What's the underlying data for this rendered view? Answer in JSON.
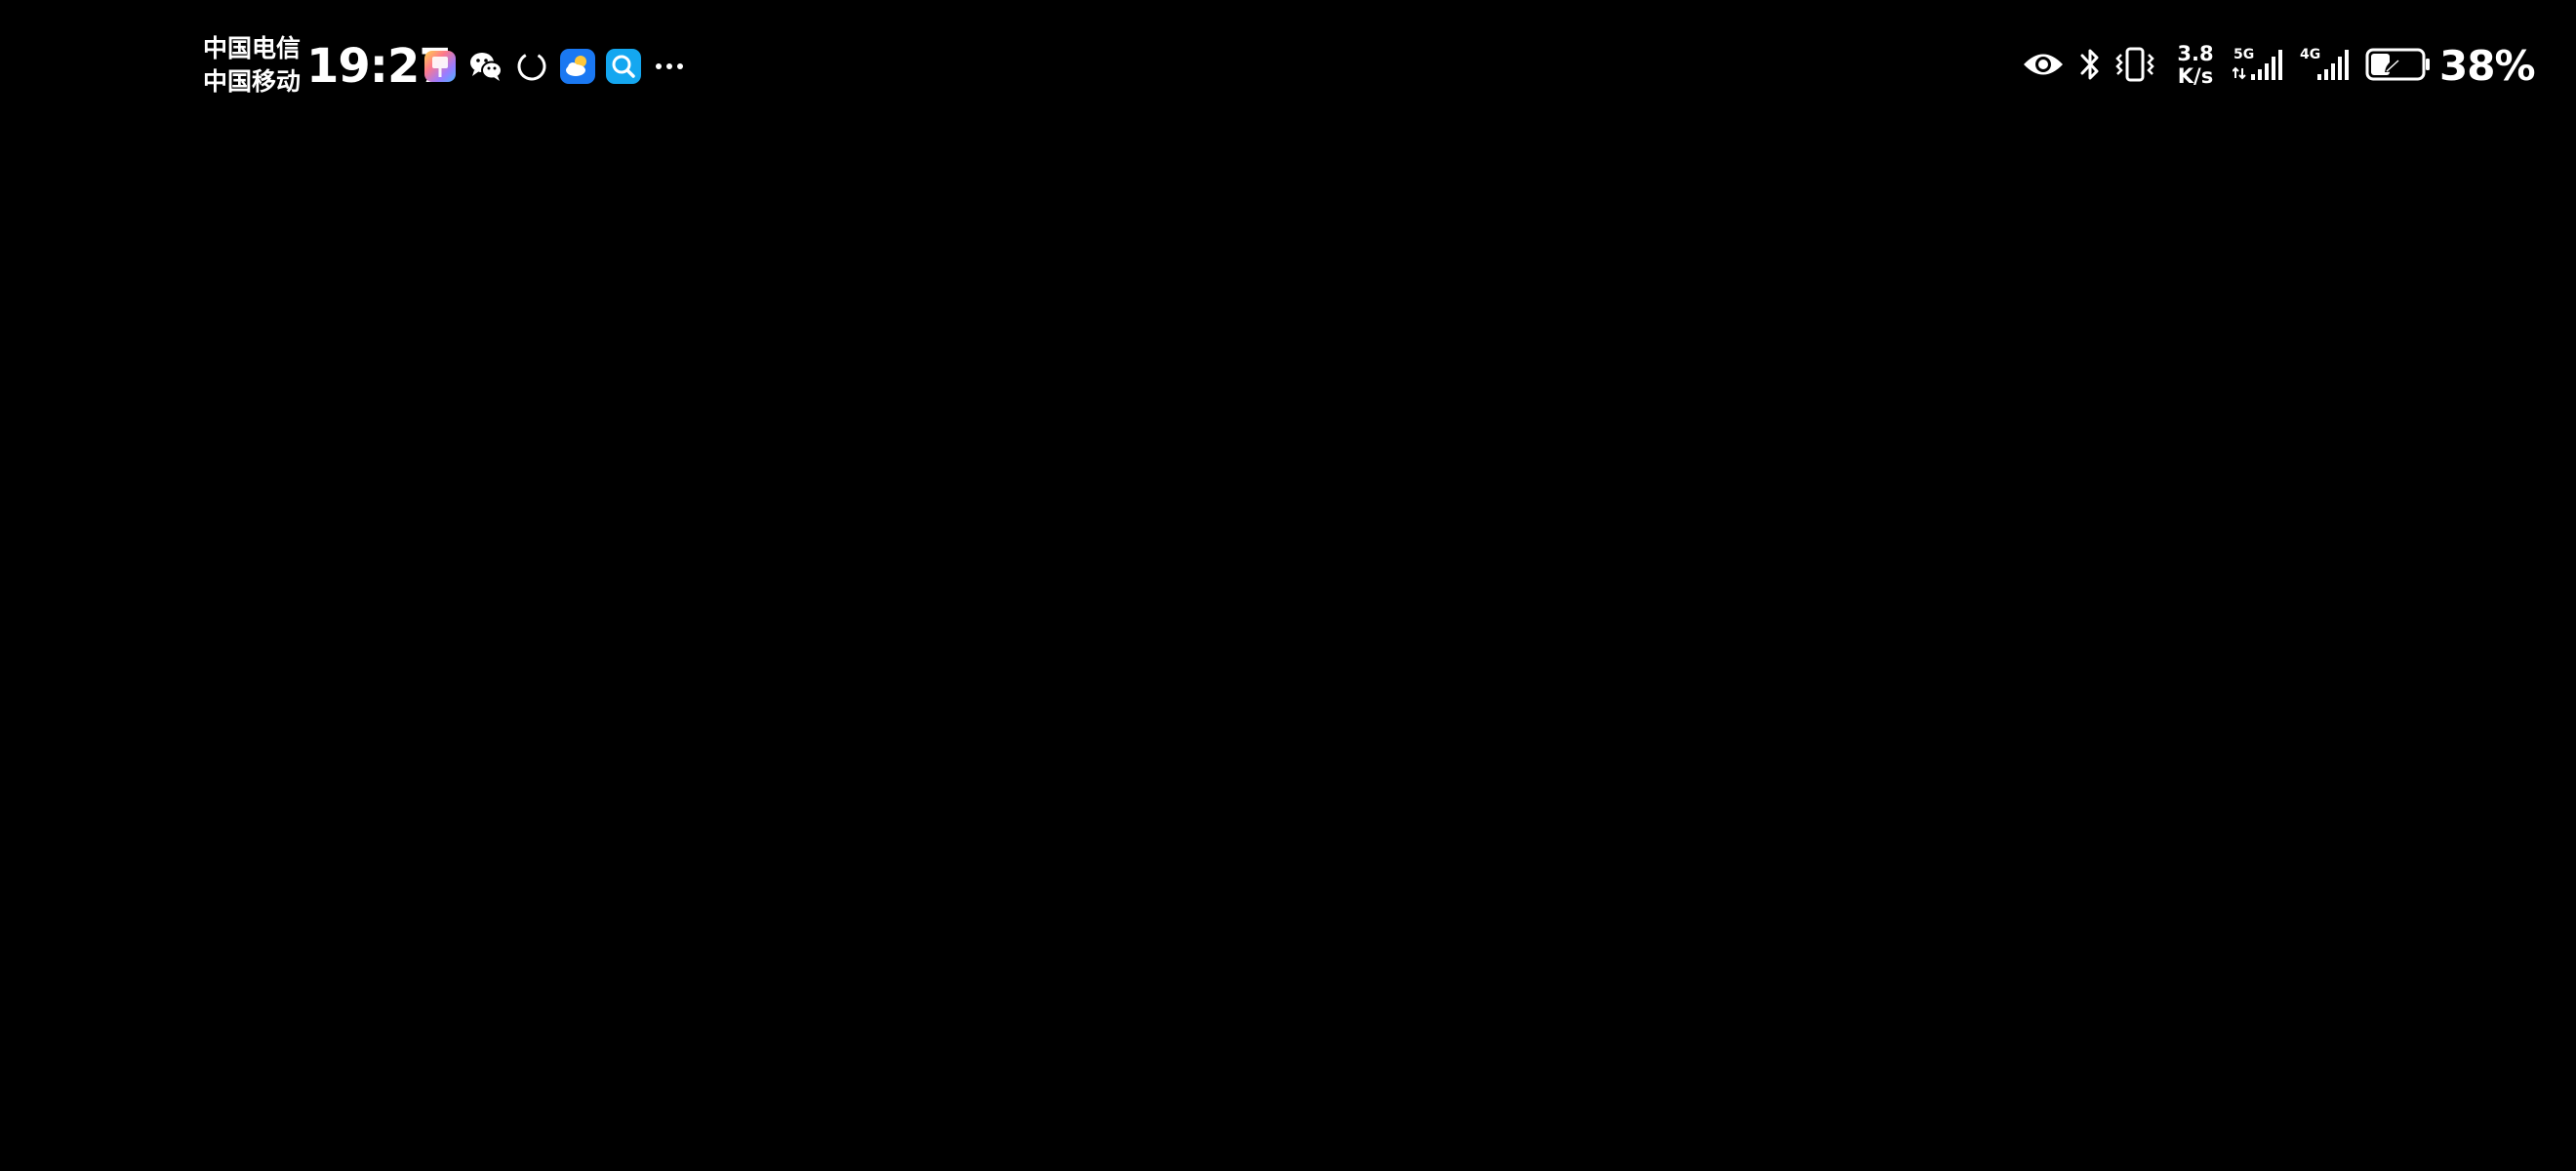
{
  "status_bar": {
    "carriers": [
      "中国电信",
      "中国移动"
    ],
    "time": "19:27",
    "notification_icons": [
      "gallery-app-icon",
      "wechat-icon",
      "loading-circle-icon",
      "weather-app-icon",
      "search-app-icon",
      "more-dots-icon"
    ],
    "system_icons": [
      "eye-comfort-icon",
      "bluetooth-icon",
      "vibrate-icon",
      "signal-5g-icon",
      "signal-4g-icon",
      "battery-saver-icon"
    ],
    "network_speed": {
      "value": "3.8",
      "unit": "K/s"
    },
    "network_5g_label": "5G",
    "network_4g_label": "4G",
    "battery_percent": "38%",
    "battery_level": 0.38
  },
  "colors": {
    "background": "#000000",
    "foreground": "#ffffff"
  }
}
